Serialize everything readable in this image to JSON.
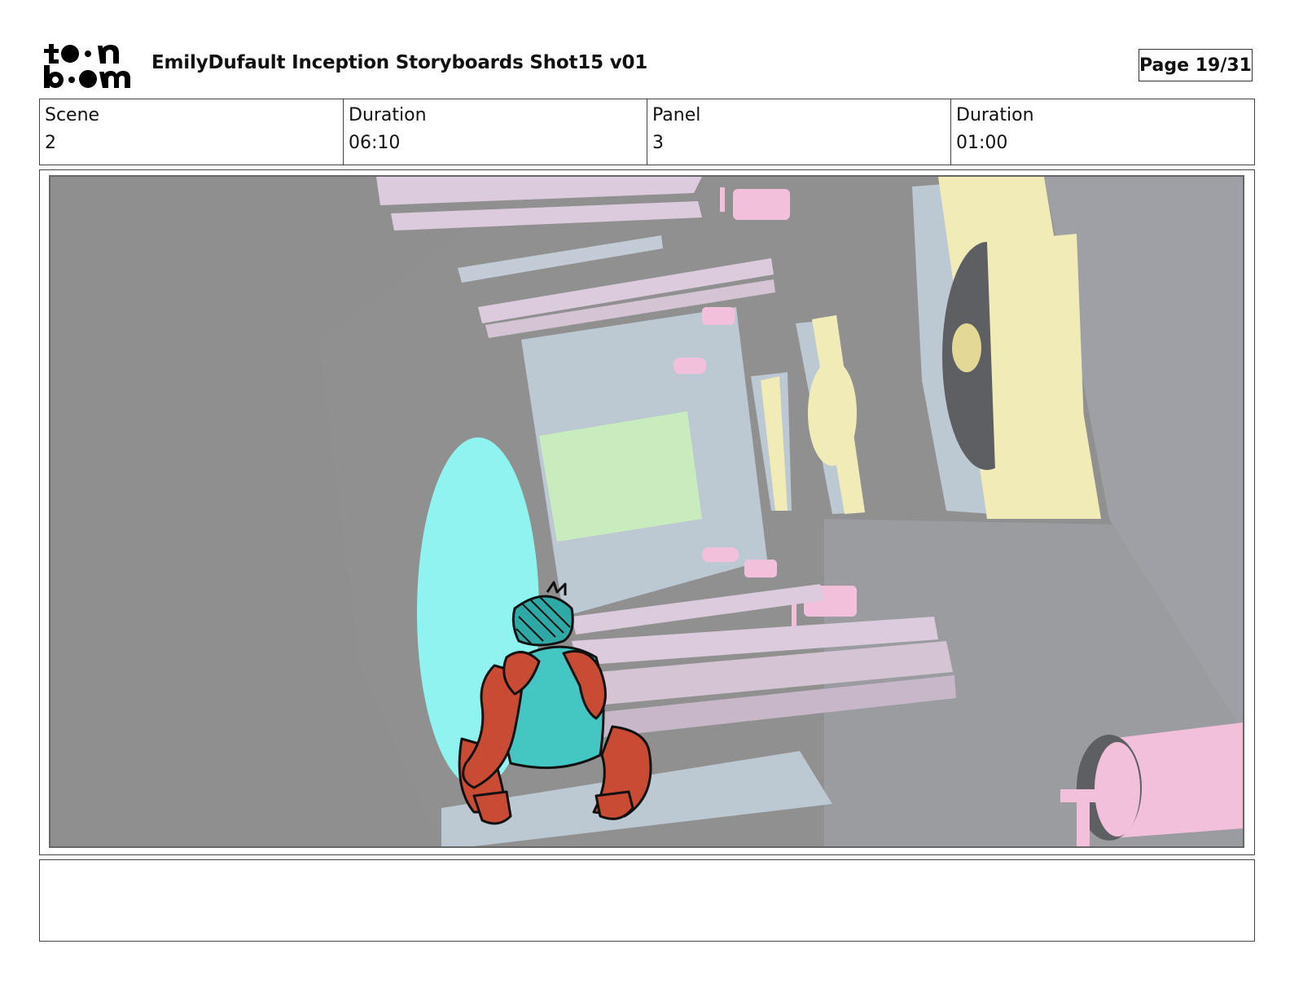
{
  "header": {
    "logo_text_top": "toon",
    "logo_text_bottom": "boom",
    "title": "EmilyDufault Inception Storyboards Shot15 v01",
    "page": "Page 19/31"
  },
  "info": {
    "scene_label": "Scene",
    "scene_value": "2",
    "scene_duration_label": "Duration",
    "scene_duration_value": "06:10",
    "panel_label": "Panel",
    "panel_value": "3",
    "panel_duration_label": "Duration",
    "panel_duration_value": "01:00"
  },
  "notes": {
    "text": ""
  },
  "colors": {
    "background_gray": "#8f8f8f",
    "pink": "#f3c0dc",
    "light_blue": "#bcc8d2",
    "yellow": "#f1ebb8",
    "green": "#c9ecbf",
    "cyan": "#8ff3f0",
    "shirt_teal": "#44c7c2",
    "skin_red": "#c94b33"
  }
}
